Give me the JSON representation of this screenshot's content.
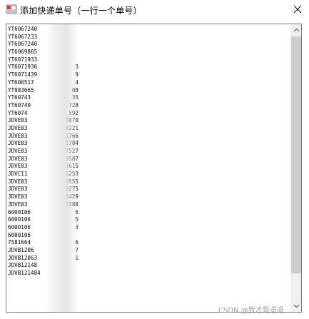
{
  "window": {
    "title": "添加快递单号（一行一个单号）",
    "close_symbol": "✕"
  },
  "textarea": {
    "lines": [
      {
        "prefix": "YT6067240",
        "suffix": ""
      },
      {
        "prefix": "YT6067233",
        "suffix": ""
      },
      {
        "prefix": "YT6067240",
        "suffix": ""
      },
      {
        "prefix": "YT6069865",
        "suffix": ""
      },
      {
        "prefix": "YT6071933",
        "suffix": ""
      },
      {
        "prefix": "YT6071936",
        "suffix": "3"
      },
      {
        "prefix": "YT6071439",
        "suffix": "9"
      },
      {
        "prefix": "YT606517",
        "suffix": "4"
      },
      {
        "prefix": "YT983665",
        "suffix": "08"
      },
      {
        "prefix": "YT60743",
        "suffix": "35"
      },
      {
        "prefix": "YT60740",
        "suffix": "728"
      },
      {
        "prefix": "YT6074",
        "suffix": "592"
      },
      {
        "prefix": "JDVE03",
        "suffix": "3870"
      },
      {
        "prefix": "JDVE03",
        "suffix": "4221"
      },
      {
        "prefix": "JDVE03",
        "suffix": "1766"
      },
      {
        "prefix": "JDVE03",
        "suffix": "1784"
      },
      {
        "prefix": "JDVE03",
        "suffix": "7527"
      },
      {
        "prefix": "JDVE03",
        "suffix": "3587"
      },
      {
        "prefix": "JDVE03",
        "suffix": "3615"
      },
      {
        "prefix": "JDVC11",
        "suffix": "3253"
      },
      {
        "prefix": "JDVE03",
        "suffix": "3555"
      },
      {
        "prefix": "JDVE03",
        "suffix": "3275"
      },
      {
        "prefix": "JDVE03",
        "suffix": "3429"
      },
      {
        "prefix": "JDVE03",
        "suffix": "3380"
      },
      {
        "prefix": "6000106",
        "suffix": "6"
      },
      {
        "prefix": "6000106",
        "suffix": "5"
      },
      {
        "prefix": "6000106",
        "suffix": "3"
      },
      {
        "prefix": "6000106",
        "suffix": ""
      },
      {
        "prefix": "7581664",
        "suffix": "6"
      },
      {
        "prefix": "JDVB1206",
        "suffix": "7"
      },
      {
        "prefix": "JDVB12063",
        "suffix": "1"
      },
      {
        "prefix": "JDVB12148",
        "suffix": ""
      },
      {
        "prefix": "JDVB121484",
        "suffix": ""
      }
    ]
  },
  "scrollbar": {
    "up_icon": "▲",
    "down_icon": "▼"
  },
  "watermark": "CSDN @我才是退退"
}
